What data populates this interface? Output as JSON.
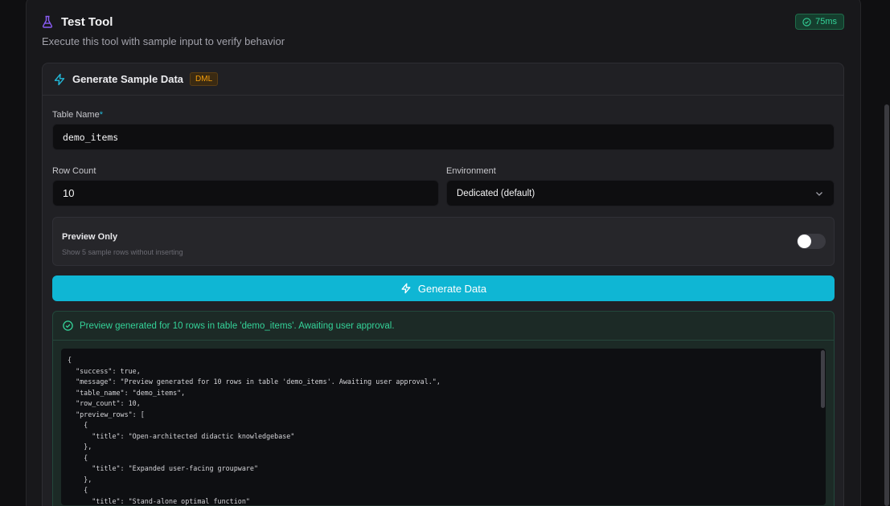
{
  "header": {
    "title": "Test Tool",
    "subtitle": "Execute this tool with sample input to verify behavior",
    "timing": "75ms",
    "flask_icon": "flask-icon",
    "timing_icon": "check-circle-icon"
  },
  "tool": {
    "title": "Generate Sample Data",
    "badge": "DML",
    "icon": "lightning-bolt-icon"
  },
  "form": {
    "table_name_label": "Table Name",
    "required_marker": "*",
    "table_name_value": "demo_items",
    "row_count_label": "Row Count",
    "row_count_value": "10",
    "environment_label": "Environment",
    "environment_value": "Dedicated (default)",
    "preview_title": "Preview Only",
    "preview_desc": "Show 5 sample rows without inserting",
    "preview_enabled": false,
    "submit_label": "Generate Data"
  },
  "result": {
    "message": "Preview generated for 10 rows in table 'demo_items'. Awaiting user approval.",
    "json_text": "{\n  \"success\": true,\n  \"message\": \"Preview generated for 10 rows in table 'demo_items'. Awaiting user approval.\",\n  \"table_name\": \"demo_items\",\n  \"row_count\": 10,\n  \"preview_rows\": [\n    {\n      \"title\": \"Open-architected didactic knowledgebase\"\n    },\n    {\n      \"title\": \"Expanded user-facing groupware\"\n    },\n    {\n      \"title\": \"Stand-alone optimal function\""
  },
  "colors": {
    "accent": "#0fb6d4",
    "success": "#34d399",
    "warning": "#f59e0b",
    "flask": "#8b5cf6"
  }
}
